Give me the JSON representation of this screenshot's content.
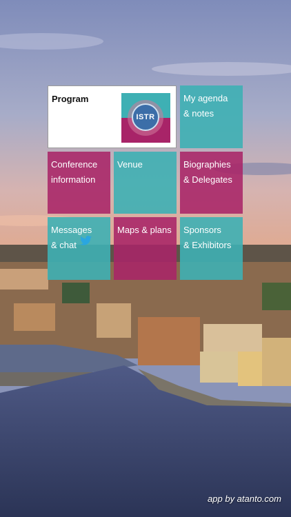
{
  "tiles": {
    "program": "Program",
    "agenda": "My agenda\n& notes",
    "conference": "Conference\ninformation",
    "venue": "Venue",
    "biographies": "Biographies\n& Delegates",
    "messages": "Messages\n& chat",
    "maps": "Maps & plans",
    "sponsors": "Sponsors\n& Exhibitors"
  },
  "logo": {
    "text": "ISTR"
  },
  "footer": "app by atanto.com",
  "colors": {
    "teal": "#3eb0b4",
    "magenta": "#a82468",
    "twitter": "#2aa6e0"
  },
  "icons": {
    "twitter": "twitter-icon"
  }
}
